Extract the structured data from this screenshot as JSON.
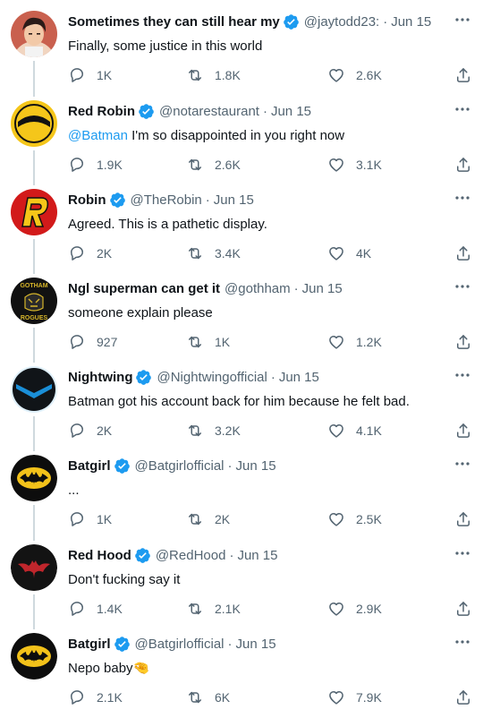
{
  "tweets": [
    {
      "name": "Sometimes they can still hear my",
      "verified": true,
      "handle": "@jaytodd23:",
      "time": "Jun 15",
      "text": "Finally, some justice in this world",
      "mention": "",
      "replies": "1K",
      "retweets": "1.8K",
      "likes": "2.6K",
      "avatar_icon": "jay-todd-avatar"
    },
    {
      "name": "Red Robin",
      "verified": true,
      "handle": "@notarestaurant",
      "time": "Jun 15",
      "text": " I'm so disappointed in you right now",
      "mention": "@Batman",
      "replies": "1.9K",
      "retweets": "2.6K",
      "likes": "3.1K",
      "avatar_icon": "red-robin-avatar"
    },
    {
      "name": "Robin",
      "verified": true,
      "handle": "@TheRobin",
      "time": "Jun 15",
      "text": "Agreed. This is a pathetic display.",
      "mention": "",
      "replies": "2K",
      "retweets": "3.4K",
      "likes": "4K",
      "avatar_icon": "robin-avatar"
    },
    {
      "name": "Ngl superman can get it",
      "verified": false,
      "handle": "@gothham",
      "time": "Jun 15",
      "text": "someone explain please",
      "mention": "",
      "replies": "927",
      "retweets": "1K",
      "likes": "1.2K",
      "avatar_icon": "gotham-rogues-avatar",
      "avatar_text_top": "GOTHAM",
      "avatar_text_bottom": "ROGUES"
    },
    {
      "name": "Nightwing",
      "verified": true,
      "handle": "@Nightwingofficial",
      "time": "Jun 15",
      "text": "Batman got his account back for him because he felt bad.",
      "mention": "",
      "replies": "2K",
      "retweets": "3.2K",
      "likes": "4.1K",
      "avatar_icon": "nightwing-avatar"
    },
    {
      "name": "Batgirl",
      "verified": true,
      "handle": "@Batgirlofficial",
      "time": "Jun 15",
      "text": "...",
      "mention": "",
      "replies": "1K",
      "retweets": "2K",
      "likes": "2.5K",
      "avatar_icon": "batgirl-avatar"
    },
    {
      "name": "Red Hood",
      "verified": true,
      "handle": "@RedHood",
      "time": "Jun 15",
      "text": "Don't fucking say it",
      "mention": "",
      "replies": "1.4K",
      "retweets": "2.1K",
      "likes": "2.9K",
      "avatar_icon": "red-hood-avatar"
    },
    {
      "name": "Batgirl",
      "verified": true,
      "handle": "@Batgirlofficial",
      "time": "Jun 15",
      "text": "Nepo baby🤏",
      "mention": "",
      "replies": "2.1K",
      "retweets": "6K",
      "likes": "7.9K",
      "avatar_icon": "batgirl-avatar"
    }
  ],
  "separator": "·",
  "colors": {
    "accent": "#1d9bf0",
    "muted": "#536471",
    "text": "#0f1419",
    "thread_line": "#cfd9de"
  }
}
